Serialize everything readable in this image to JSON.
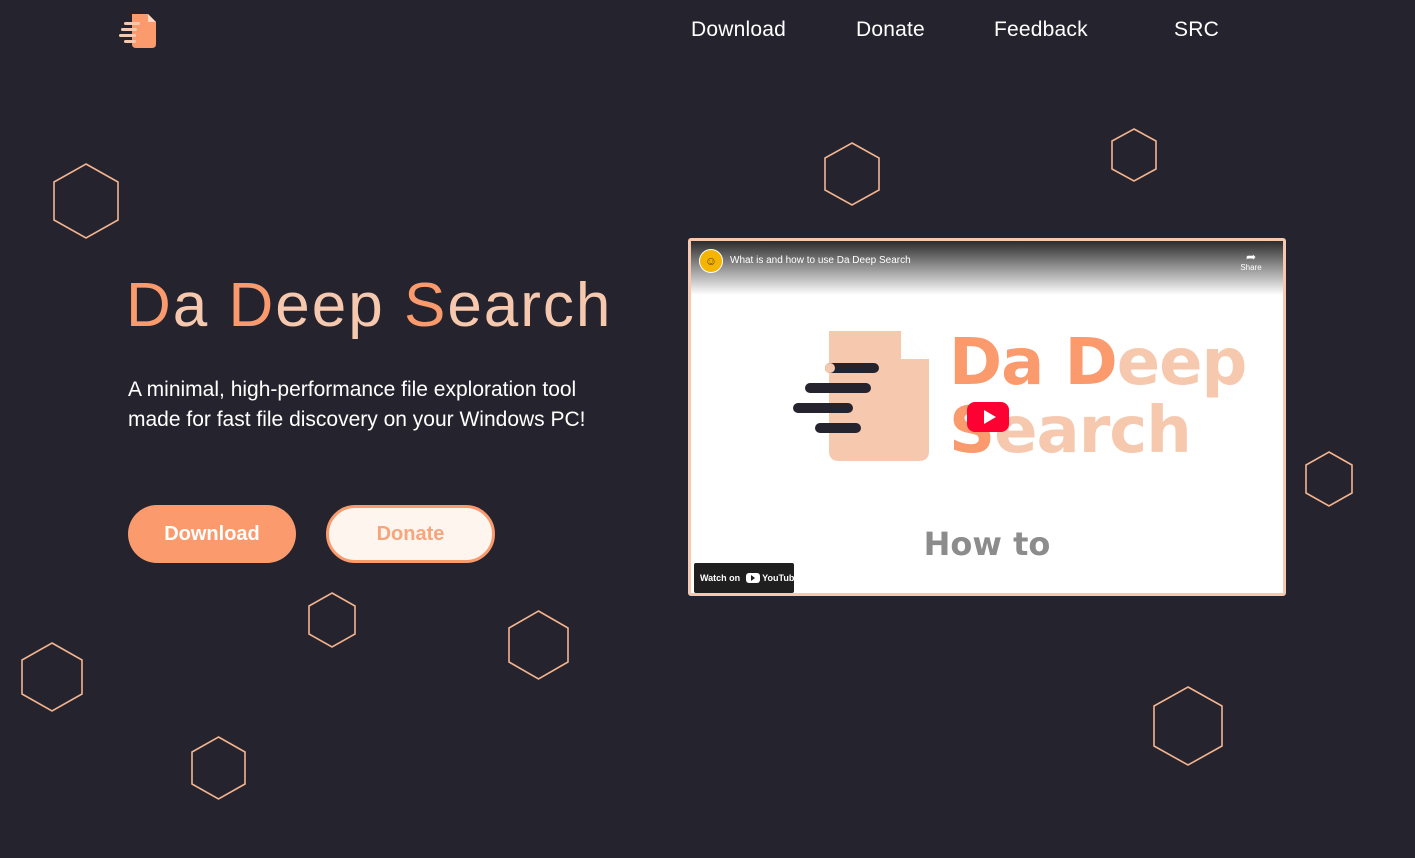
{
  "nav": {
    "logo_name": "file-search-logo-icon",
    "items": [
      "Download",
      "Donate",
      "Feedback",
      "SRC"
    ]
  },
  "hero": {
    "title_parts": [
      "D",
      "a ",
      "D",
      "eep ",
      "S",
      "earch"
    ],
    "description": "A minimal, high-performance file exploration tool made for fast file discovery on your Windows PC!",
    "download_label": "Download",
    "donate_label": "Donate"
  },
  "video": {
    "title": "What is and how to use Da Deep Search",
    "share_label": "Share",
    "thumb_line1_parts": [
      "Da",
      " ",
      "D",
      "eep"
    ],
    "thumb_line2_parts": [
      "S",
      "earch"
    ],
    "subtitle": "How to",
    "watch_on_label": "Watch on",
    "youtube_label": "YouTube"
  },
  "colors": {
    "background": "#25242e",
    "accent": "#fb9a6c",
    "accent_light": "#f6c9af",
    "hexagon_stroke": "#f4b48f",
    "play_button": "#ff0033"
  }
}
